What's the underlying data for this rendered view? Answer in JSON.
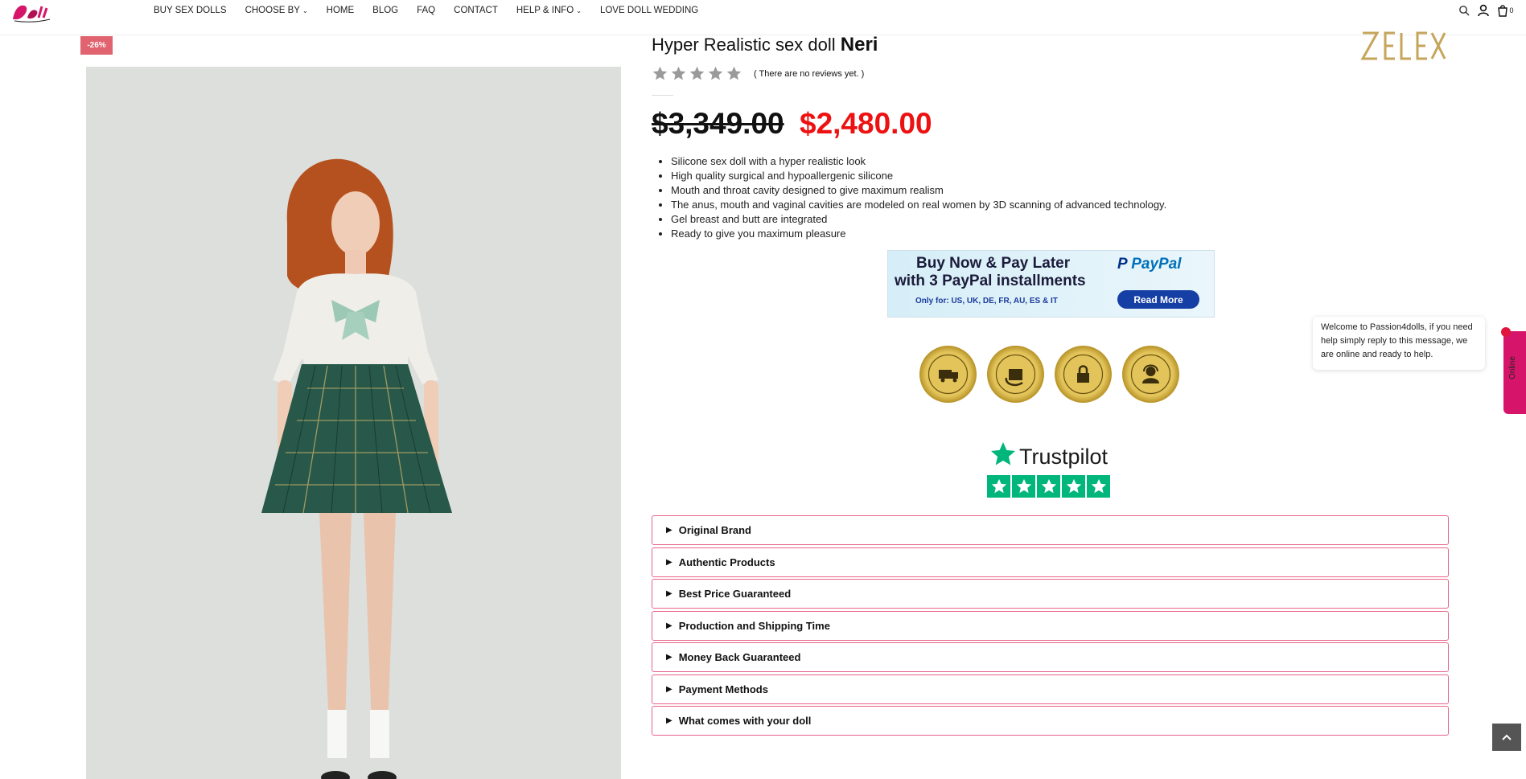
{
  "nav": {
    "items": [
      {
        "label": "BUY SEX DOLLS",
        "has_dropdown": false
      },
      {
        "label": "CHOOSE BY",
        "has_dropdown": true
      },
      {
        "label": "HOME",
        "has_dropdown": false
      },
      {
        "label": "BLOG",
        "has_dropdown": false
      },
      {
        "label": "FAQ",
        "has_dropdown": false
      },
      {
        "label": "CONTACT",
        "has_dropdown": false
      },
      {
        "label": "HELP & INFO",
        "has_dropdown": true
      },
      {
        "label": "LOVE DOLL WEDDING",
        "has_dropdown": false
      }
    ],
    "cart_count": "0",
    "icons": [
      "search-icon",
      "user-icon",
      "cart-icon"
    ]
  },
  "product": {
    "discount_badge": "-26%",
    "title_prefix": "Hyper Realistic sex doll",
    "title_name": "Neri",
    "brand_logo_text": "ZELEX",
    "rating": 0,
    "reviews_text": "( There are no reviews yet. )",
    "old_price": "$3,349.00",
    "new_price": "$2,480.00",
    "features": [
      "Silicone sex doll with a hyper realistic look",
      "High quality surgical and hypoallergenic silicone",
      "Mouth and throat cavity designed to give maximum realism",
      "The anus, mouth and vaginal cavities are modeled on real women by 3D scanning of advanced technology.",
      "Gel breast and butt are integrated",
      "Ready to give you maximum pleasure"
    ]
  },
  "paypal_banner": {
    "line1": "Buy Now & Pay Later",
    "line2": "with 3 PayPal installments",
    "line3": "Only for: US, UK, DE, FR, AU, ES & IT",
    "logo": "PayPal",
    "button": "Read More"
  },
  "seals": [
    {
      "text": "FAST & FREE SHIPPING"
    },
    {
      "text": "FREE & EASY RETURNS"
    },
    {
      "text": "100% SECURE PAYMENT"
    },
    {
      "text": "GREAT CUSTOMER SERVICE"
    }
  ],
  "trustpilot": {
    "word": "Trustpilot",
    "stars": 5
  },
  "accordion": [
    "Original Brand",
    "Authentic Products",
    "Best Price Guaranteed",
    "Production and Shipping Time",
    "Money Back Guaranteed",
    "Payment Methods",
    "What comes with your doll"
  ],
  "chat": {
    "message": "Welcome to Passion4dolls, if you need help simply reply to this message, we are online and ready to help.",
    "tab_label": "Online"
  },
  "colors": {
    "accent_pink": "#e8648a",
    "price_red": "#ee1111",
    "badge": "#e0636f",
    "trustpilot_green": "#00b67a",
    "chat_tab": "#d6156a"
  }
}
